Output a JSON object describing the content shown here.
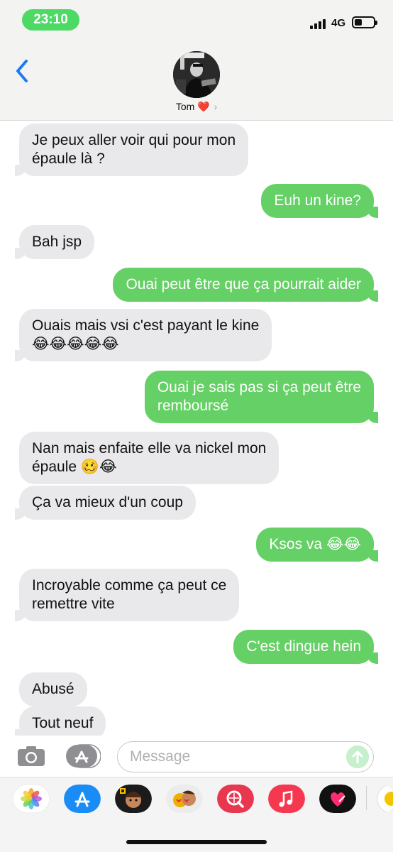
{
  "status": {
    "time": "23:10",
    "network": "4G"
  },
  "contact": {
    "name": "Tom",
    "heart": "❤️",
    "chevron": "›"
  },
  "messages": [
    {
      "from": "them",
      "lines": [
        "Je peux aller voir qui pour mon",
        "épaule là ?"
      ]
    },
    {
      "from": "me",
      "lines": [
        "Euh un kine?"
      ]
    },
    {
      "from": "them",
      "lines": [
        "Bah jsp"
      ]
    },
    {
      "from": "me",
      "lines": [
        "Ouai peut être que ça pourrait aider"
      ]
    },
    {
      "from": "them",
      "lines": [
        "Ouais mais vsi c'est payant le kine",
        "😂😂😂😂😂"
      ]
    },
    {
      "from": "me",
      "lines": [
        "Ouai je sais pas si ça peut être",
        "remboursé"
      ]
    },
    {
      "from": "them",
      "lines": [
        "Nan mais enfaite elle va nickel mon",
        "épaule 🥴😂"
      ]
    },
    {
      "from": "them",
      "lines": [
        "Ça va mieux d'un coup"
      ]
    },
    {
      "from": "me",
      "lines": [
        "Ksos va 😂😂"
      ]
    },
    {
      "from": "them",
      "lines": [
        "Incroyable comme ça peut ce",
        "remettre vite"
      ]
    },
    {
      "from": "me",
      "lines": [
        "C'est dingue hein"
      ]
    },
    {
      "from": "them",
      "lines": [
        "Abusé"
      ]
    },
    {
      "from": "them",
      "lines": [
        "Tout neuf"
      ]
    }
  ],
  "composer": {
    "placeholder": "Message"
  },
  "app_drawer": [
    {
      "icon": "photos-app-icon"
    },
    {
      "icon": "app-store-app-icon"
    },
    {
      "icon": "memoji-app-icon"
    },
    {
      "icon": "animoji-app-icon"
    },
    {
      "icon": "image-search-app-icon"
    },
    {
      "icon": "music-app-icon"
    },
    {
      "icon": "digital-touch-app-icon"
    },
    {
      "icon": "more-app-icon"
    }
  ],
  "colors": {
    "sent": "#65d066",
    "received": "#e9e9eb",
    "ios_blue": "#1a7cf5",
    "time_pill": "#4cd964"
  }
}
